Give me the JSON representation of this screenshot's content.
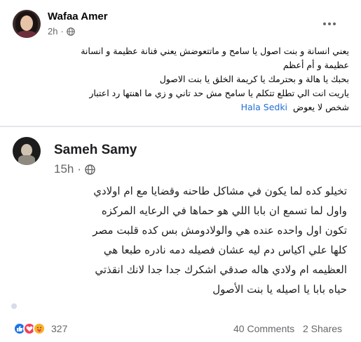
{
  "post": {
    "author": "Wafaa Amer",
    "time": "2h",
    "text_lines": [
      "يعني انسانة و بنت اصول يا سامح و ماتتعوضش يعني فنانة عظيمة و انسانة",
      "عظيمة و أم أعظم",
      "بحبك يا هالة و بحترمك يا كريمة الخلق يا بنت الاصول",
      "ياريت انت الي تطلع تتكلم يا سامح مش حد تاني و زي ما اهنتها رد اعتبار",
      "شخص لا يعوض"
    ],
    "mention": "Hala Sedki"
  },
  "shared": {
    "author": "Sameh Samy",
    "time": "15h",
    "text_lines": [
      "تخيلو كده لما يكون في مشاكل طاحنه وقضايا مع ام اولادي",
      "واول لما تسمع ان بابا اللي هو حماها في الرعايه المركزه",
      "تكون اول واحده عنده هي والولادومش بس كده قلبت مصر",
      "كلها علي اكياس دم ليه عشان فصيله دمه نادره طبعا هي",
      "العظيمه ام ولادي هاله صدقي اشكرك جدا جدا لانك انقذتي",
      "حياه بابا يا اصيله يا بنت الأصول"
    ]
  },
  "footer": {
    "reaction_count": "327",
    "comments": "40 Comments",
    "shares": "2 Shares"
  },
  "icons": {
    "privacy": "globe-icon",
    "menu": "more-options-icon",
    "reactions": [
      "like-icon",
      "love-icon",
      "care-icon"
    ]
  },
  "colors": {
    "link": "#216fdb",
    "like": "#1b74e4",
    "love": "#f33e58",
    "care": "#f7b125",
    "secondary_text": "#65676b"
  }
}
